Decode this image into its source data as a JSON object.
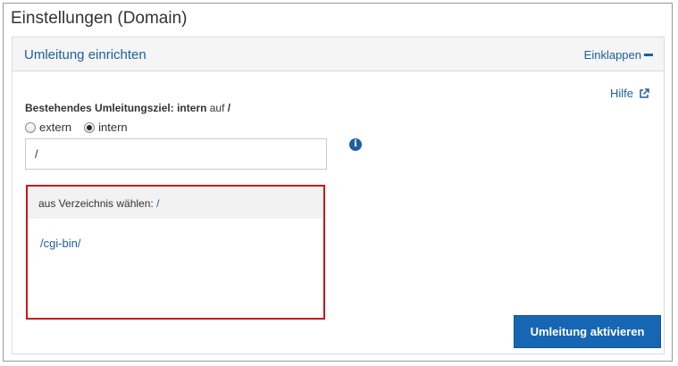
{
  "page": {
    "title": "Einstellungen (Domain)"
  },
  "panel": {
    "title": "Umleitung einrichten",
    "collapse_label": "Einklappen",
    "help_label": "Hilfe"
  },
  "existing_target": {
    "label": "Bestehendes Umleitungsziel:",
    "type": "intern",
    "connector": "auf",
    "path": "/"
  },
  "radio_options": [
    {
      "label": "extern",
      "checked": false
    },
    {
      "label": "intern",
      "checked": true
    }
  ],
  "path_input": {
    "value": "/"
  },
  "directory_picker": {
    "header_label": "aus Verzeichnis wählen:",
    "current_path": "/",
    "items": [
      "/cgi-bin/"
    ]
  },
  "activate_button": {
    "label": "Umleitung aktivieren"
  },
  "colors": {
    "accent": "#1d5fa0",
    "button": "#1666b3",
    "highlight_border": "#c8161d"
  },
  "icons": {
    "collapse": "minus-icon",
    "help": "external-link-icon",
    "info": "info-icon"
  }
}
